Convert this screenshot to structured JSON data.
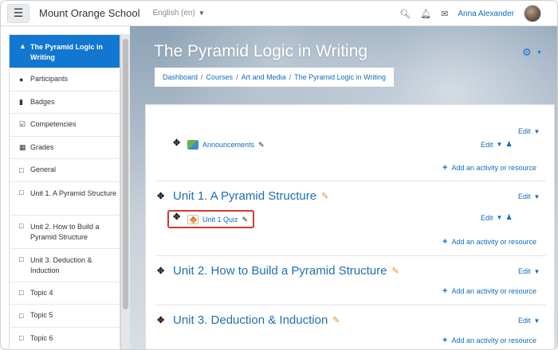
{
  "navbar": {
    "menu_icon": "hamburger-icon",
    "site_name": "Mount Orange School",
    "language": "English (en)",
    "search_icon": "search-icon",
    "bell_icon": "bell-icon",
    "chat_icon": "chat-icon",
    "user_name": "Anna Alexander"
  },
  "sidebar": {
    "items": [
      {
        "label": "The Pyramid Logic in Writing",
        "icon": "graduation-cap-icon"
      },
      {
        "label": "Participants",
        "icon": "users-icon"
      },
      {
        "label": "Badges",
        "icon": "shield-icon"
      },
      {
        "label": "Competencies",
        "icon": "check-square-icon"
      },
      {
        "label": "Grades",
        "icon": "table-icon"
      },
      {
        "label": "General",
        "icon": "folder-icon"
      },
      {
        "label": "Unit 1. A Pyramid Structure",
        "icon": "folder-icon"
      },
      {
        "label": "Unit 2. How to Build a Pyramid Structure",
        "icon": "folder-icon"
      },
      {
        "label": "Unit 3. Deduction & Induction",
        "icon": "folder-icon"
      },
      {
        "label": "Topic 4",
        "icon": "folder-icon"
      },
      {
        "label": "Topic 5",
        "icon": "folder-icon"
      },
      {
        "label": "Topic 6",
        "icon": "folder-icon"
      }
    ]
  },
  "header": {
    "title": "The Pyramid Logic in Writing",
    "breadcrumb": [
      "Dashboard",
      "Courses",
      "Art and Media",
      "The Pyramid Logic in Writing"
    ]
  },
  "content": {
    "edit_label": "Edit",
    "add_label": "Add an activity or resource",
    "general": {
      "activity": "Announcements"
    },
    "sections": [
      {
        "title": "Unit 1. A Pyramid Structure",
        "activity": "Unit 1 Quiz"
      },
      {
        "title": "Unit 2. How to Build a Pyramid Structure"
      },
      {
        "title": "Unit 3. Deduction & Induction"
      }
    ]
  },
  "colors": {
    "accent": "#1177d1",
    "link": "#0f6cbf",
    "highlight": "#d23a2e"
  }
}
